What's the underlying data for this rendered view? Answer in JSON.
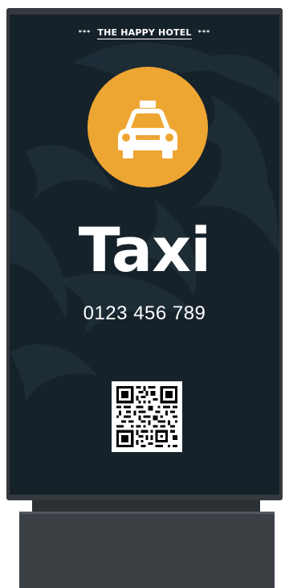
{
  "sign": {
    "header": {
      "stars_left": "***",
      "hotel_name": "THE HAPPY HOTEL",
      "stars_right": "***"
    },
    "icon": "taxi-icon",
    "title": "Taxi",
    "phone": "0123 456 789",
    "qr_code": "qr-code-icon"
  },
  "colors": {
    "screen_background": "#16222a",
    "accent_circle": "#eea633",
    "text": "#ffffff",
    "frame": "#35393d"
  }
}
